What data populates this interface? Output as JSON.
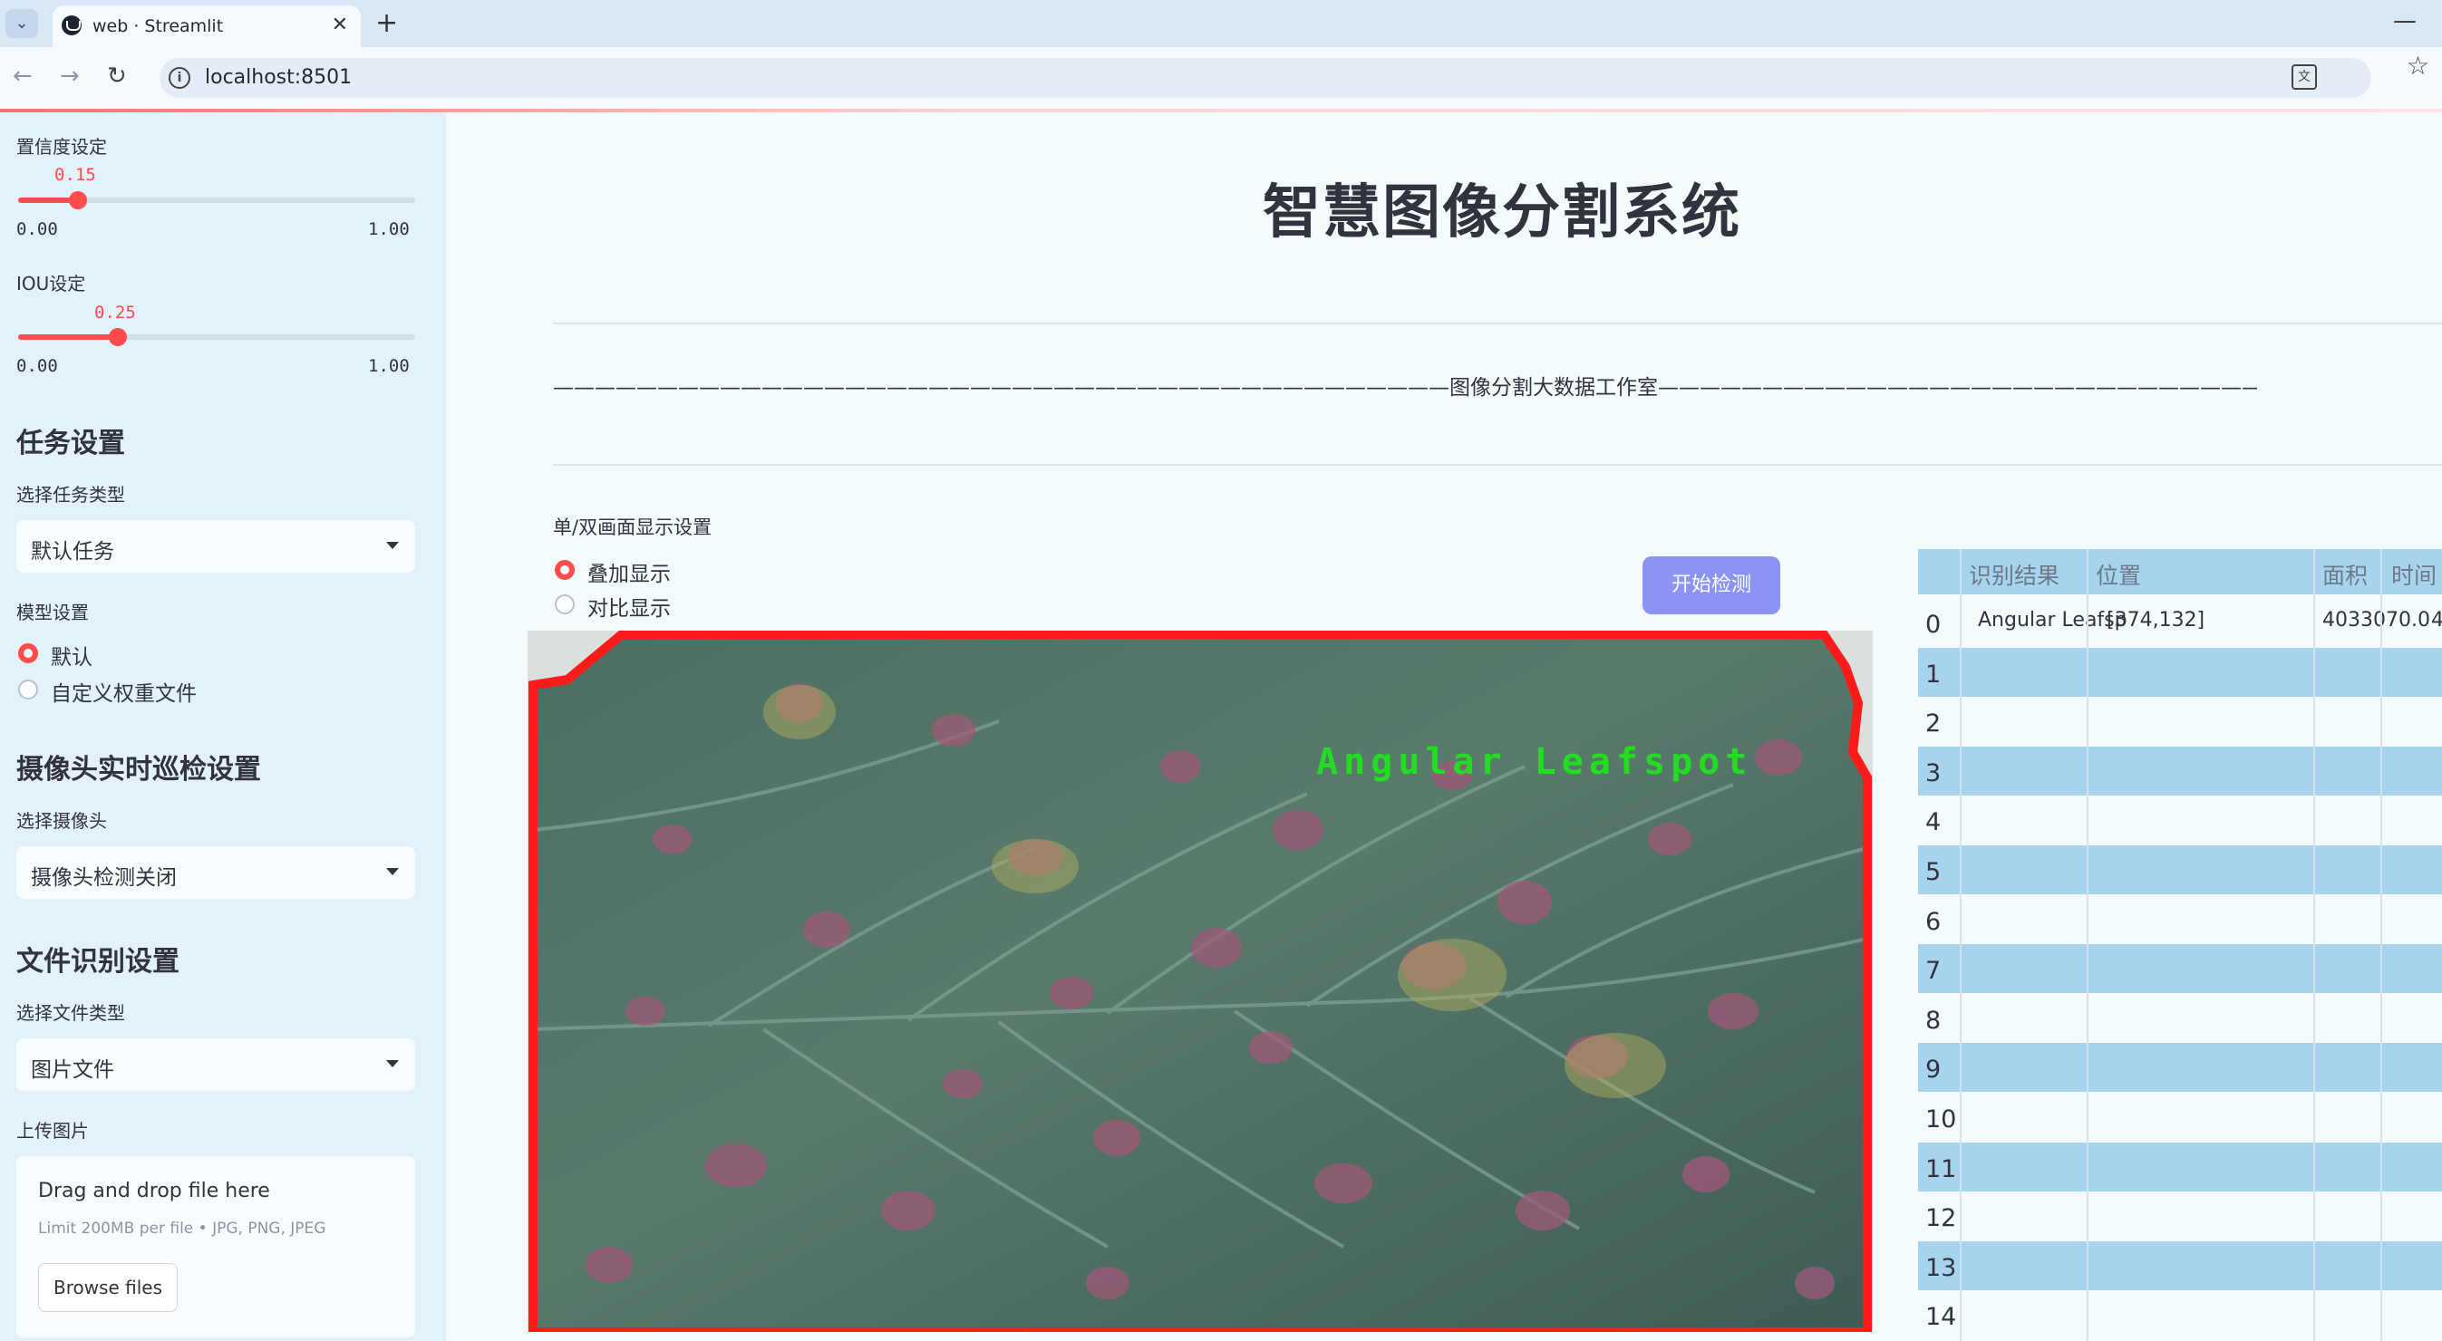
{
  "browser": {
    "tab_title": "web · Streamlit",
    "url": "localhost:8501"
  },
  "sidebar": {
    "confidence": {
      "label": "置信度设定",
      "value": "0.15",
      "min": "0.00",
      "max": "1.00",
      "fraction": 0.15
    },
    "iou": {
      "label": "IOU设定",
      "value": "0.25",
      "min": "0.00",
      "max": "1.00",
      "fraction": 0.25
    },
    "task_heading": "任务设置",
    "task_type_label": "选择任务类型",
    "task_type_value": "默认任务",
    "model_label": "模型设置",
    "model_options": [
      "默认",
      "自定义权重文件"
    ],
    "model_selected": 0,
    "camera_heading": "摄像头实时巡检设置",
    "camera_label": "选择摄像头",
    "camera_value": "摄像头检测关闭",
    "file_heading": "文件识别设置",
    "file_type_label": "选择文件类型",
    "file_type_value": "图片文件",
    "upload_label": "上传图片",
    "upload_title": "Drag and drop file here",
    "upload_hint": "Limit 200MB per file • JPG, PNG, JPEG",
    "browse_label": "Browse files"
  },
  "main": {
    "title": "智慧图像分割系统",
    "banner": "———————————————————————————————————————————图像分割大数据工作室————————————————————————————————————————————",
    "display_label": "单/双画面显示设置",
    "display_options": [
      "叠加显示",
      "对比显示"
    ],
    "display_selected": 0,
    "start_button": "开始检测",
    "detection_label": "Angular Leafspot"
  },
  "results_table": {
    "columns": [
      "识别结果",
      "位置",
      "面积",
      "时间"
    ],
    "rows": [
      {
        "index": "0",
        "result": "Angular Leafsp",
        "position": "[374,132]",
        "area": "4033070.0",
        "time": "4"
      },
      {
        "index": "1"
      },
      {
        "index": "2"
      },
      {
        "index": "3"
      },
      {
        "index": "4"
      },
      {
        "index": "5"
      },
      {
        "index": "6"
      },
      {
        "index": "7"
      },
      {
        "index": "8"
      },
      {
        "index": "9"
      },
      {
        "index": "10"
      },
      {
        "index": "11"
      },
      {
        "index": "12"
      },
      {
        "index": "13"
      },
      {
        "index": "14"
      }
    ]
  },
  "colors": {
    "accent": "#ff4b4b",
    "button": "#8b93f5",
    "sidebar_bg": "#e3f1fb",
    "table_stripe": "#a8d3ef",
    "mask_outline": "#ff1a1a",
    "label_green": "#22dd22"
  }
}
